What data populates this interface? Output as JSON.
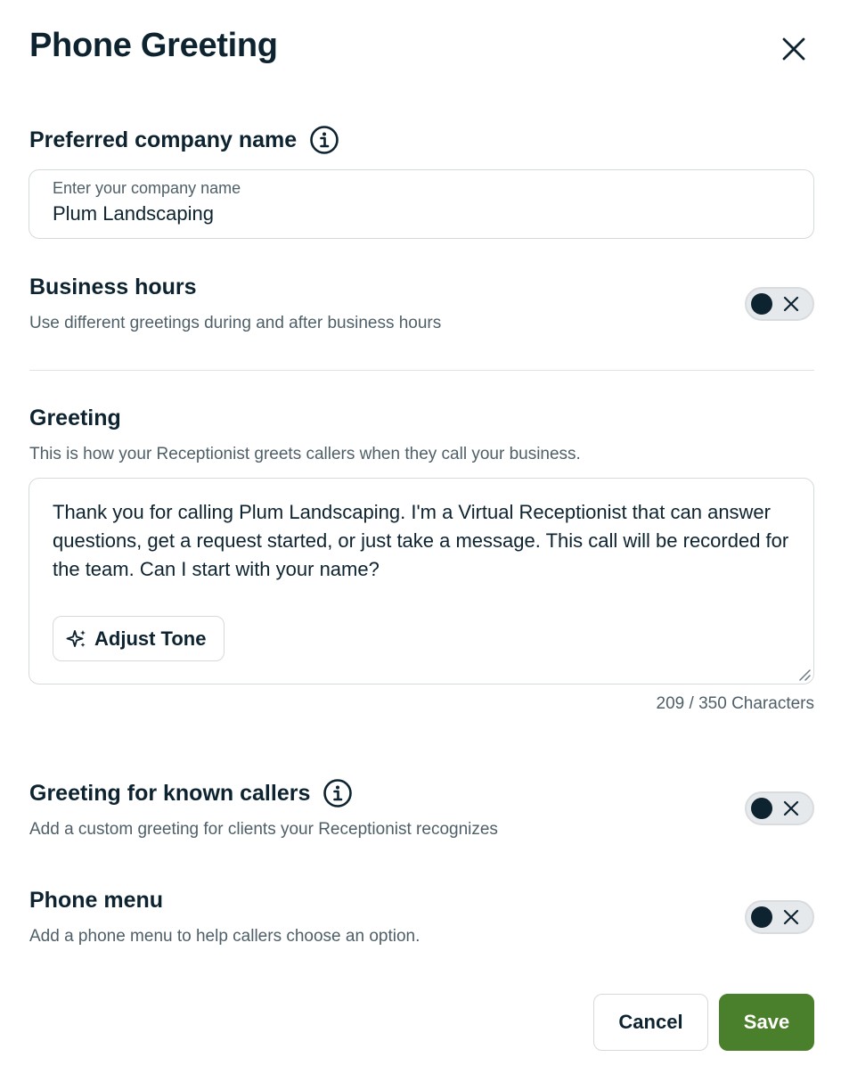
{
  "dialog": {
    "title": "Phone Greeting",
    "close_icon": "close-icon"
  },
  "company_name": {
    "label": "Preferred company name",
    "info_icon": "info-icon",
    "field_label": "Enter your company name",
    "value": "Plum Landscaping"
  },
  "business_hours": {
    "label": "Business hours",
    "description": "Use different greetings during and after business hours",
    "enabled": false
  },
  "greeting": {
    "label": "Greeting",
    "description": "This is how your Receptionist greets callers when they call your business.",
    "text": "Thank you for calling Plum Landscaping. I'm a Virtual Receptionist that can answer questions, get a request started, or just take a message. This call will be recorded for the team. Can I start with your name?",
    "adjust_tone_label": "Adjust Tone",
    "adjust_tone_icon": "sparkle-icon",
    "char_count": "209 / 350 Characters"
  },
  "known_callers": {
    "label": "Greeting for known callers",
    "info_icon": "info-icon",
    "description": "Add a custom greeting for clients your Receptionist recognizes",
    "enabled": false
  },
  "phone_menu": {
    "label": "Phone menu",
    "description": "Add a phone menu to help callers choose an option.",
    "enabled": false
  },
  "actions": {
    "cancel_label": "Cancel",
    "save_label": "Save"
  },
  "colors": {
    "primary_text": "#0d2330",
    "secondary_text": "#4f5f68",
    "save_button": "#4a7f2b",
    "border": "#d5dadd"
  }
}
